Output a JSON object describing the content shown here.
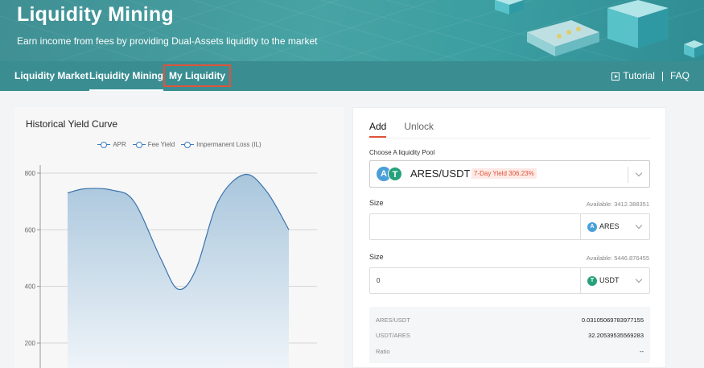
{
  "header": {
    "title": "Liquidity Mining",
    "subtitle": "Earn income from fees by providing Dual-Assets liquidity to the market"
  },
  "nav": {
    "items": [
      {
        "label": "Liquidity Market"
      },
      {
        "label": "Liquidity Mining"
      },
      {
        "label": "My Liquidity"
      }
    ],
    "tutorial_label": "Tutorial",
    "faq_label": "FAQ"
  },
  "chart_panel": {
    "title": "Historical Yield Curve",
    "legend": [
      "APR",
      "Fee Yield",
      "Impermanent Loss (IL)"
    ]
  },
  "chart_data": {
    "type": "area",
    "title": "Historical Yield Curve",
    "legend_placement": "top-center",
    "grid": true,
    "yticks": [
      200,
      400,
      600,
      800
    ],
    "ylim": [
      140,
      820
    ],
    "series": [
      {
        "name": "APR",
        "points": [
          [
            0,
            730
          ],
          [
            0.08,
            745
          ],
          [
            0.2,
            740
          ],
          [
            0.3,
            700
          ],
          [
            0.42,
            500
          ],
          [
            0.5,
            390
          ],
          [
            0.58,
            460
          ],
          [
            0.68,
            700
          ],
          [
            0.8,
            795
          ],
          [
            0.9,
            735
          ],
          [
            1,
            600
          ]
        ]
      }
    ],
    "colors": {
      "line": "#3a73ad",
      "fill_top": "#a9c6dc",
      "fill_bottom": "#eef4f9"
    }
  },
  "form": {
    "tabs": [
      {
        "label": "Add"
      },
      {
        "label": "Unlock"
      }
    ],
    "pool_label": "Choose A liquidity Pool",
    "pool": {
      "name": "ARES/USDT",
      "yield_badge": "7-Day Yield 306.23%",
      "coin_a": "A",
      "coin_b": "T"
    },
    "size1": {
      "label": "Size",
      "available": "Available: 3412.388351",
      "value": "",
      "token": "ARES",
      "coin": "A"
    },
    "size2": {
      "label": "Size",
      "available": "Available: 5446.876455",
      "value": "0",
      "token": "USDT",
      "coin": "T"
    },
    "info": [
      {
        "label": "ARES/USDT",
        "value": "0.03105069783977155"
      },
      {
        "label": "USDT/ARES",
        "value": "32.20539535569283"
      },
      {
        "label": "Ratio",
        "value": "--"
      }
    ]
  },
  "colors": {
    "accent": "#e0533a",
    "header_teal": "#3a8e92",
    "ares_blue": "#4a9fd8",
    "usdt_green": "#26a17b"
  }
}
